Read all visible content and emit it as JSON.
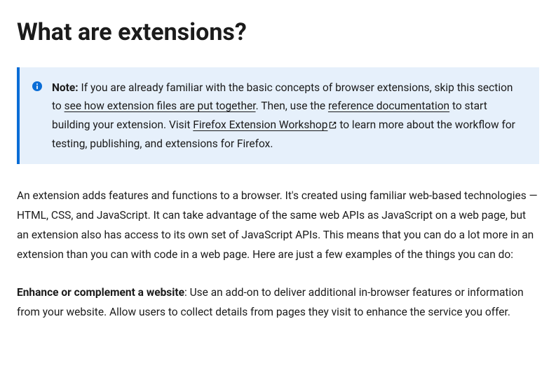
{
  "title": "What are extensions?",
  "note": {
    "prefix": "Note:",
    "segments": [
      " If you are already familiar with the basic concepts of browser extensions, skip this section to ",
      "see how extension files are put together",
      ". Then, use the ",
      "reference documentation",
      " to start building your extension. Visit ",
      "Firefox Extension Workshop",
      " to learn more about the workflow for testing, publishing, and extensions for Firefox."
    ]
  },
  "paragraph1": "An extension adds features and functions to a browser. It's created using familiar web-based technologies — HTML, CSS, and JavaScript. It can take advantage of the same web APIs as JavaScript on a web page, but an extension also has access to its own set of JavaScript APIs. This means that you can do a lot more in an extension than you can with code in a web page. Here are just a few examples of the things you can do:",
  "paragraph2_bold": "Enhance or complement a website",
  "paragraph2_rest": ": Use an add-on to deliver additional in-browser features or information from your website. Allow users to collect details from pages they visit to enhance the service you offer."
}
